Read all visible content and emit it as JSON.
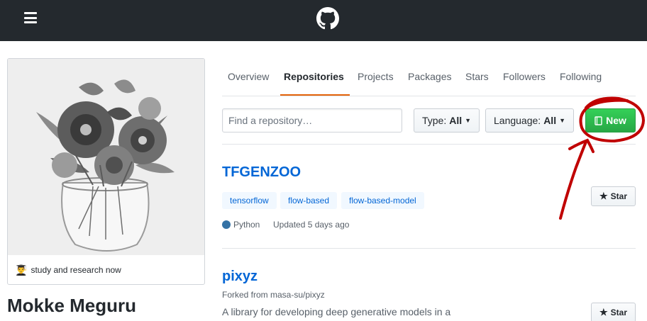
{
  "header": {
    "menu_icon": "hamburger-icon",
    "logo_icon": "github-octocat-icon"
  },
  "profile": {
    "status_emoji": "👨‍🎓",
    "status_text": "study and research now",
    "name": "Mokke Meguru"
  },
  "tabs": [
    {
      "label": "Overview",
      "selected": false
    },
    {
      "label": "Repositories",
      "selected": true
    },
    {
      "label": "Projects",
      "selected": false
    },
    {
      "label": "Packages",
      "selected": false
    },
    {
      "label": "Stars",
      "selected": false
    },
    {
      "label": "Followers",
      "selected": false
    },
    {
      "label": "Following",
      "selected": false
    }
  ],
  "filters": {
    "search_placeholder": "Find a repository…",
    "type_label": "Type:",
    "type_value": "All",
    "language_label": "Language:",
    "language_value": "All",
    "new_label": "New"
  },
  "repos": [
    {
      "name": "TFGENZOO",
      "topics": [
        "tensorflow",
        "flow-based",
        "flow-based-model"
      ],
      "language": "Python",
      "language_color": "#3572a5",
      "updated": "Updated 5 days ago",
      "star_label": "Star"
    },
    {
      "name": "pixyz",
      "forked_from": "Forked from masa-su/pixyz",
      "description": "A library for developing deep generative models in a",
      "star_label": "Star"
    }
  ],
  "colors": {
    "header_bg": "#24292e",
    "link": "#0366d6",
    "new_button": "#28a745",
    "tab_underline": "#e36209",
    "annotation": "#c00000"
  }
}
